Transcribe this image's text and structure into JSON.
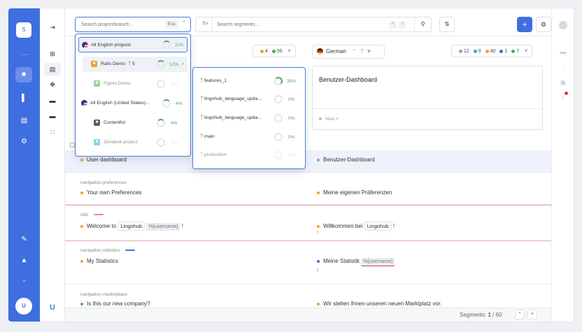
{
  "nav": {
    "workspace": "S",
    "logo": "U"
  },
  "sidebar2": {
    "logo": "U"
  },
  "toolbar": {
    "project_search_placeholder": "Search project/branch...",
    "esc_label": "Esc",
    "segment_search_placeholder": "Search segments...",
    "kbd1": "^",
    "kbd2": "/",
    "add_label": "+"
  },
  "source_column": {
    "count_orange": "4",
    "count_green": "56"
  },
  "target_column": {
    "language": "German",
    "badges": [
      "12",
      "0",
      "40",
      "1",
      "7"
    ]
  },
  "card": {
    "text": "Benutzer-Dashboard",
    "status": "New"
  },
  "rows": [
    {
      "key": "",
      "source": "User dashboard",
      "target": "Benutzer-Dashboard"
    },
    {
      "key": "navigation.preferences",
      "source": "Your own Preferences",
      "target": "Meine eigenen Präferenzen"
    },
    {
      "key": "ddd",
      "source_pre": "Welcome to",
      "source_ph1": "Lingohub",
      "source_ph2": "%{username}",
      "source_post": "!",
      "target_pre": "Willkommen bei",
      "target_ph1": "Lingohub",
      "target_post": "!",
      "warn": "!"
    },
    {
      "key": "navigation.statistics",
      "source": "My Statistics",
      "target_pre": "Meine Statistik",
      "target_ph": "%{username}",
      "warn": "!"
    },
    {
      "key": "navigation.marketplace",
      "source": "Is this our new company?",
      "target": "Wir stellen Ihnen unseren neuen Marktplatz vor."
    }
  ],
  "footer": {
    "label": "Segments:",
    "current": "1",
    "total": "/ 60"
  },
  "project_dropdown": {
    "items": [
      {
        "label": "All English projects",
        "pct": "11%"
      },
      {
        "label": "Rails Demo",
        "branches": "5",
        "pct": "12%"
      },
      {
        "label": "Figma Demo",
        "pct": "0%"
      },
      {
        "label": "All English (United States)...",
        "pct": "4%"
      },
      {
        "label": "Contentful",
        "pct": "4%"
      },
      {
        "label": "Zendesk project",
        "pct": "0%"
      }
    ]
  },
  "branch_dropdown": {
    "items": [
      {
        "label": "features_1",
        "pct": "38%"
      },
      {
        "label": "lingohub_language_upda...",
        "pct": "0%"
      },
      {
        "label": "lingohub_language_upda...",
        "pct": "0%"
      },
      {
        "label": "main",
        "pct": "0%"
      },
      {
        "label": "production",
        "pct": "0%"
      }
    ]
  }
}
